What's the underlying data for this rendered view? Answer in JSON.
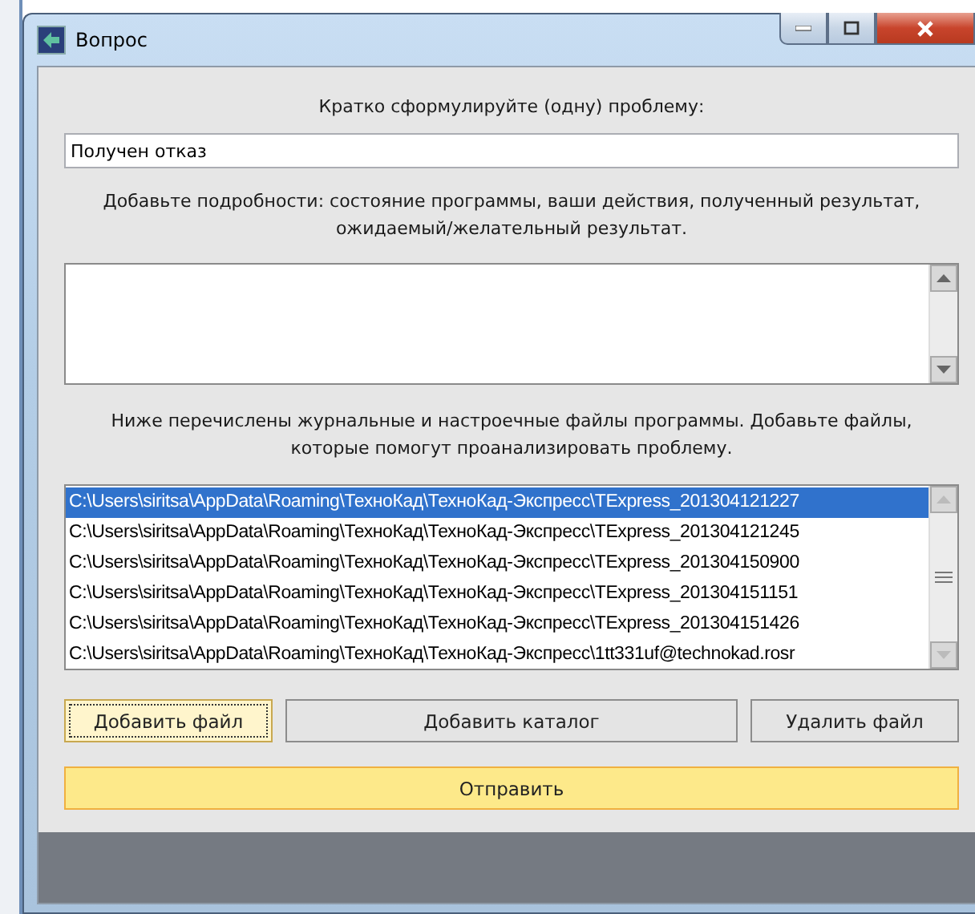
{
  "window": {
    "title": "Вопрос"
  },
  "summary": {
    "label": "Кратко сформулируйте (одну) проблему:",
    "value": "Получен отказ"
  },
  "details": {
    "label": "Добавьте подробности: состояние программы, ваши действия, полученный результат, ожидаемый/желательный результат."
  },
  "files": {
    "label": "Ниже перечислены журнальные и настроечные файлы программы. Добавьте файлы, которые помогут проанализировать проблему.",
    "items": [
      {
        "path": "C:\\Users\\siritsa\\AppData\\Roaming\\ТехноКад\\ТехноКад-Экспресс\\TExpress_201304121227",
        "selected": true
      },
      {
        "path": "C:\\Users\\siritsa\\AppData\\Roaming\\ТехноКад\\ТехноКад-Экспресс\\TExpress_201304121245",
        "selected": false
      },
      {
        "path": "C:\\Users\\siritsa\\AppData\\Roaming\\ТехноКад\\ТехноКад-Экспресс\\TExpress_201304150900",
        "selected": false
      },
      {
        "path": "C:\\Users\\siritsa\\AppData\\Roaming\\ТехноКад\\ТехноКад-Экспресс\\TExpress_201304151151",
        "selected": false
      },
      {
        "path": "C:\\Users\\siritsa\\AppData\\Roaming\\ТехноКад\\ТехноКад-Экспресс\\TExpress_201304151426",
        "selected": false
      },
      {
        "path": "C:\\Users\\siritsa\\AppData\\Roaming\\ТехноКад\\ТехноКад-Экспресс\\1tt331uf@technokad.rosr",
        "selected": false
      }
    ]
  },
  "buttons": [
    {
      "label": "Добавить файл",
      "focused": true
    },
    {
      "label": "Добавить каталог",
      "focused": false
    },
    {
      "label": "Удалить файл",
      "focused": false
    }
  ],
  "send": {
    "label": "Отправить"
  }
}
